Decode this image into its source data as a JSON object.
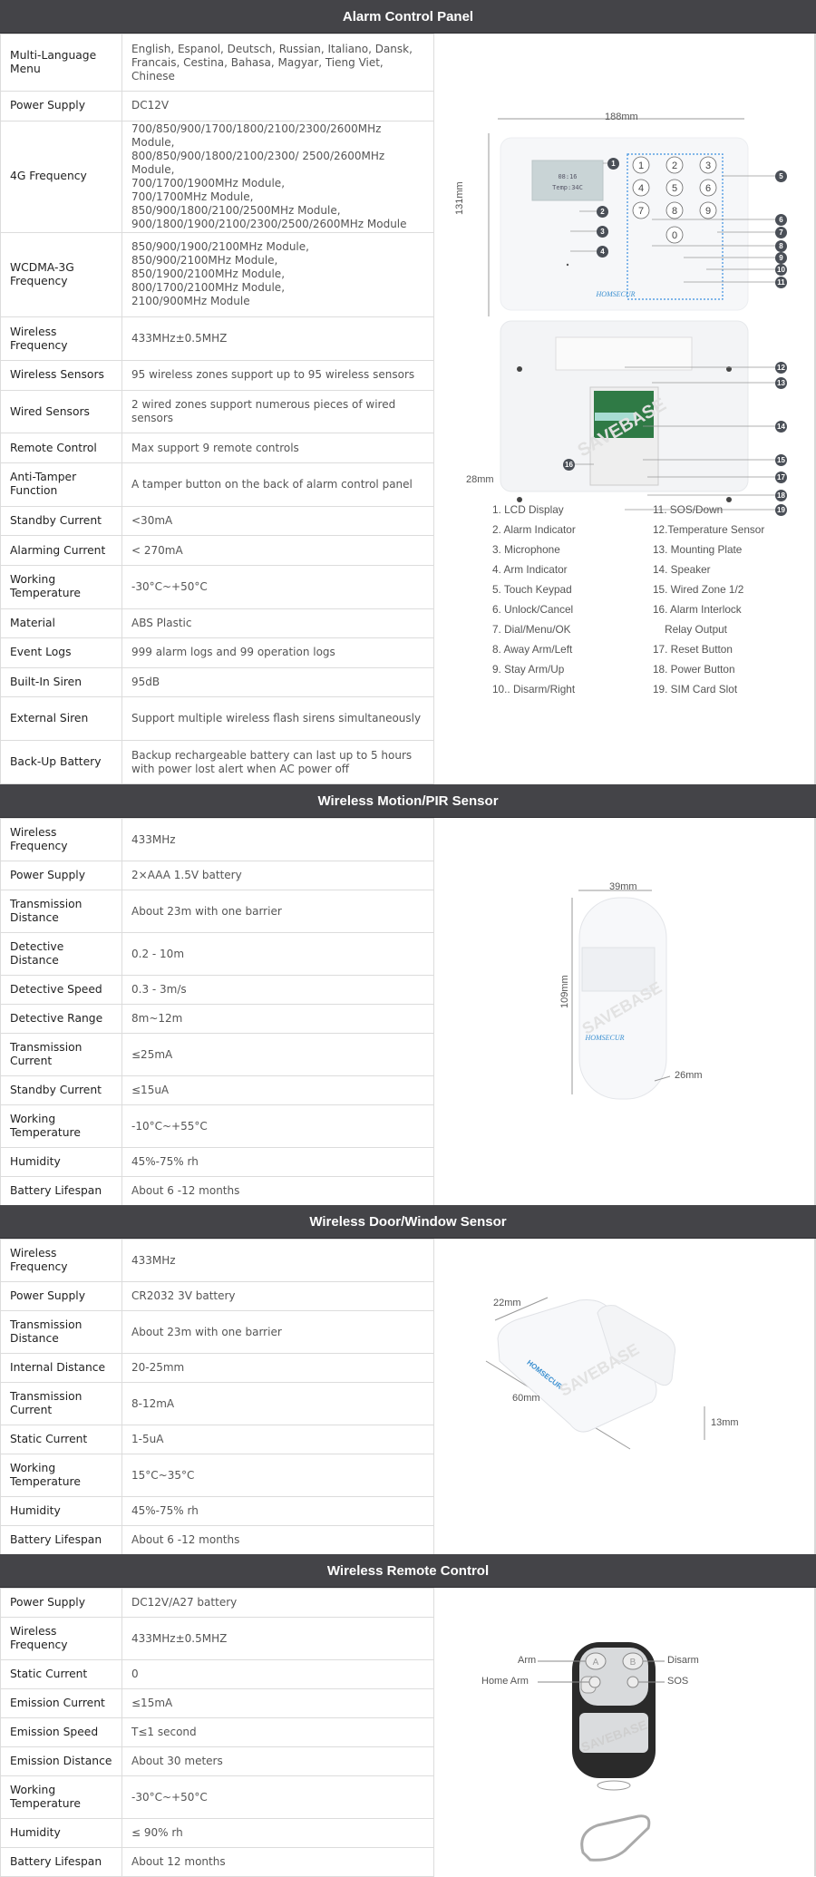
{
  "sections": [
    {
      "title": "Alarm Control Panel",
      "rows": [
        {
          "key": "Multi-Language Menu",
          "value": "English, Espanol, Deutsch, Russian, Italiano, Dansk, Francais, Cestina, Bahasa, Magyar, Tieng Viet, Chinese"
        },
        {
          "key": "Power Supply",
          "value": "DC12V"
        },
        {
          "key": "4G Frequency",
          "value": "700/850/900/1700/1800/2100/2300/2600MHz Module,\n800/850/900/1800/2100/2300/ 2500/2600MHz Module,\n700/1700/1900MHz Module,\n700/1700MHz Module,\n850/900/1800/2100/2500MHz Module,\n900/1800/1900/2100/2300/2500/2600MHz Module"
        },
        {
          "key": "WCDMA-3G Frequency",
          "value": "850/900/1900/2100MHz Module,\n850/900/2100MHz Module,\n850/1900/2100MHz Module,\n800/1700/2100MHz Module,\n2100/900MHz Module"
        },
        {
          "key": "Wireless Frequency",
          "value": "433MHz±0.5MHZ"
        },
        {
          "key": "Wireless Sensors",
          "value": "95 wireless zones support up to 95 wireless sensors"
        },
        {
          "key": "Wired Sensors",
          "value": "2 wired zones support numerous pieces of wired sensors"
        },
        {
          "key": "Remote Control",
          "value": "Max support 9 remote controls"
        },
        {
          "key": "Anti-Tamper Function",
          "value": "A tamper button on the back of alarm control panel"
        },
        {
          "key": "Standby Current",
          "value": "<30mA"
        },
        {
          "key": "Alarming Current",
          "value": "< 270mA"
        },
        {
          "key": "Working Temperature",
          "value": "-30°C~+50°C"
        },
        {
          "key": "Material",
          "value": "ABS Plastic"
        },
        {
          "key": "Event Logs",
          "value": "999 alarm logs and 99 operation logs"
        },
        {
          "key": "Built-In Siren",
          "value": "95dB"
        },
        {
          "key": "External Siren",
          "value": "Support multiple wireless flash sirens simultaneously"
        },
        {
          "key": "Back-Up Battery",
          "value": "Backup rechargeable battery can last up to 5 hours with power lost alert when AC power off"
        }
      ],
      "figure": {
        "brand": "HOMSECUR",
        "watermark": "SAVEBASE",
        "lcd_time": "08:16",
        "lcd_temp": "Temp:34C",
        "dims": {
          "width": "188mm",
          "height": "131mm",
          "depth": "28mm"
        },
        "keypad": [
          "1",
          "2",
          "3",
          "4",
          "5",
          "6",
          "7",
          "8",
          "9",
          "0"
        ],
        "callouts": [
          "1",
          "2",
          "3",
          "4",
          "5",
          "6",
          "7",
          "8",
          "9",
          "10",
          "11",
          "12",
          "13",
          "14",
          "15",
          "16",
          "17",
          "18",
          "19"
        ],
        "legend_left": [
          "1. LCD Display",
          "2. Alarm Indicator",
          "3. Microphone",
          "4. Arm Indicator",
          "5. Touch Keypad",
          "6. Unlock/Cancel",
          "7. Dial/Menu/OK",
          "8. Away Arm/Left",
          "9. Stay Arm/Up",
          "10.. Disarm/Right"
        ],
        "legend_right": [
          "11. SOS/Down",
          "12.Temperature Sensor",
          "13. Mounting Plate",
          "14. Speaker",
          "15. Wired Zone 1/2",
          "16. Alarm Interlock",
          "    Relay Output",
          "17. Reset Button",
          "18. Power Button",
          "19. SIM Card Slot"
        ]
      }
    },
    {
      "title": "Wireless Motion/PIR Sensor",
      "rows": [
        {
          "key": "Wireless Frequency",
          "value": "433MHz"
        },
        {
          "key": "Power Supply",
          "value": "2×AAA 1.5V battery"
        },
        {
          "key": "Transmission Distance",
          "value": "About 23m with one barrier"
        },
        {
          "key": "Detective Distance",
          "value": "0.2 - 10m"
        },
        {
          "key": "Detective Speed",
          "value": "0.3 - 3m/s"
        },
        {
          "key": "Detective Range",
          "value": "8m~12m"
        },
        {
          "key": "Transmission Current",
          "value": "≤25mA"
        },
        {
          "key": "Standby Current",
          "value": "≤15uA"
        },
        {
          "key": "Working Temperature",
          "value": "-10°C~+55°C"
        },
        {
          "key": "Humidity",
          "value": "45%-75% rh"
        },
        {
          "key": "Battery Lifespan",
          "value": "About 6 -12 months"
        }
      ],
      "figure": {
        "brand": "HOMSECUR",
        "watermark": "SAVEBASE",
        "dims": {
          "width": "39mm",
          "height": "109mm",
          "depth": "26mm"
        }
      }
    },
    {
      "title": "Wireless Door/Window Sensor",
      "rows": [
        {
          "key": "Wireless Frequency",
          "value": "433MHz"
        },
        {
          "key": "Power Supply",
          "value": "CR2032 3V battery"
        },
        {
          "key": "Transmission Distance",
          "value": "About 23m with one barrier"
        },
        {
          "key": "Internal Distance",
          "value": "20-25mm"
        },
        {
          "key": "Transmission Current",
          "value": "8-12mA"
        },
        {
          "key": "Static Current",
          "value": "1-5uA"
        },
        {
          "key": "Working Temperature",
          "value": "15°C~35°C"
        },
        {
          "key": "Humidity",
          "value": "45%-75% rh"
        },
        {
          "key": "Battery Lifespan",
          "value": "About 6 -12 months"
        }
      ],
      "figure": {
        "brand": "HOMSECUR",
        "watermark": "SAVEBASE",
        "dims": {
          "width": "22mm",
          "length": "60mm",
          "height": "13mm"
        }
      }
    },
    {
      "title": "Wireless Remote Control",
      "rows": [
        {
          "key": "Power Supply",
          "value": "DC12V/A27 battery"
        },
        {
          "key": "Wireless Frequency",
          "value": "433MHz±0.5MHZ"
        },
        {
          "key": "Static Current",
          "value": "0"
        },
        {
          "key": "Emission Current",
          "value": "≤15mA"
        },
        {
          "key": "Emission Speed",
          "value": "T≤1 second"
        },
        {
          "key": "Emission Distance",
          "value": "About 30 meters"
        },
        {
          "key": "Working Temperature",
          "value": "-30°C~+50°C"
        },
        {
          "key": "Humidity",
          "value": "≤ 90% rh"
        },
        {
          "key": "Battery Lifespan",
          "value": "About 12 months"
        }
      ],
      "figure": {
        "watermark": "SAVEBASE",
        "buttons": {
          "a": "A",
          "b": "B"
        },
        "labels": {
          "arm": "Arm",
          "disarm": "Disarm",
          "home_arm": "Home Arm",
          "sos": "SOS"
        }
      }
    }
  ],
  "colors": {
    "header_bg": "#444448",
    "header_text": "#ffffff",
    "border": "#dcdcdc",
    "brand_blue": "#3a8fd0",
    "keypad_dash": "#3a8ee0"
  }
}
